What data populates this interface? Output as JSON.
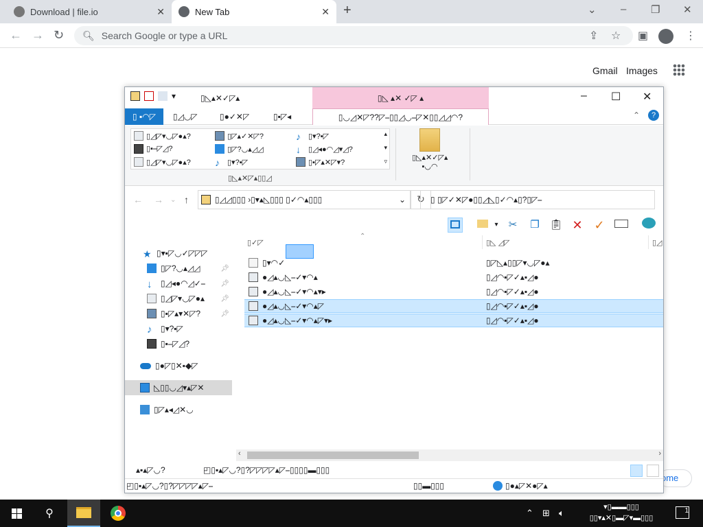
{
  "browser": {
    "tabs": [
      {
        "title": "Download | file.io",
        "active": false
      },
      {
        "title": "New Tab",
        "active": true
      }
    ],
    "omnibox_placeholder": "Search Google or type a URL"
  },
  "google": {
    "gmail": "Gmail",
    "images": "Images",
    "partial_button": "ome"
  },
  "explorer": {
    "title": "▯◺▴✕✓◸▴",
    "context_tab_header": "▯◺ ▴✕ ✓◸ ▴",
    "ribbon_tabs": [
      "▯ ▪◠◸",
      "▯◿◡◸",
      "▯●✓✕◸",
      "▯▪◸◂",
      "▯◡◿✕◸??◸⎯▯▯◿◡⎯◸✕▯▯◿◿◠?"
    ],
    "layout_items": [
      "▯◿◸▾◡◸●▴?",
      "▯◸▴✓✕◸?",
      "▯▾?▪◸",
      "▯▪⎯◸◿?",
      "▯◸?◡▴◿◿",
      "▯◿◂●◠◿▾◿?",
      "▯◿◸▾◡◸●▴?",
      "▯▾?▪◸",
      "▯▪◸▴✕◸▾?"
    ],
    "group_label": "▯◺▴✕◸▴▯▯◿",
    "sortby_label": "▯◺▴✕✓◸▴\n▪◡◠",
    "address_text": "▯◿◿▯▯▯ ›▯▾▴◺▯▯▯ ▯✓◠▴▯▯▯",
    "search_placeholder": "▯ ▯◸✓✕◸●▯▯◿◺▯✓◠▴▯?▯◸⎯",
    "columns": {
      "name": "▯✓◸",
      "type": "▯◺ ◿◸"
    },
    "files": [
      {
        "name": "▯▾◠✓",
        "type": "▯◸◺▴▯▯◸▾◡◸●▴",
        "selected": false,
        "icon": "text-file-icon"
      },
      {
        "name": "●◿▴◡◺⎯✓▾◠▴",
        "type": "▯◿◠▪◸✓▴▪◿●",
        "selected": false,
        "icon": "image-file-icon"
      },
      {
        "name": "●◿▴◡◺⎯✓▾◠▴▾▸",
        "type": "▯◿◠▪◸✓▴▪◿●",
        "selected": false,
        "icon": "image-file-icon"
      },
      {
        "name": "●◿▴◡◺⎯✓▾◠▴◸",
        "type": "▯◿◠▪◸✓▴▪◿●",
        "selected": true,
        "icon": "image-file-icon"
      },
      {
        "name": "●◿▴◡◺⎯✓▾◠▴◸▾▸",
        "type": "▯◿◠▪◸✓▴▪◿●",
        "selected": true,
        "icon": "image-file-icon"
      }
    ],
    "nav": [
      {
        "label": "▯▾▪◸◡✓◸◸◸",
        "icon": "quick-access-star-icon",
        "pinned": false
      },
      {
        "label": "▯◸?◡▴◿◿",
        "icon": "desktop-icon",
        "pinned": true
      },
      {
        "label": "▯◿◂●◠◿✓⎯",
        "icon": "downloads-icon",
        "pinned": true
      },
      {
        "label": "▯◿◸▾◡◸●▴",
        "icon": "documents-icon",
        "pinned": true
      },
      {
        "label": "▯▪◸▴▾✕◸?",
        "icon": "pictures-icon",
        "pinned": true
      },
      {
        "label": "▯▾?▪◸",
        "icon": "music-icon",
        "pinned": false
      },
      {
        "label": "▯▪⎯◸◿?",
        "icon": "videos-icon",
        "pinned": false
      },
      {
        "label": "▯●◸▯✕▪◆◸",
        "icon": "onedrive-icon",
        "pinned": false
      },
      {
        "label": "◺▯▯◡◿▾▴◸✕",
        "icon": "this-pc-icon",
        "pinned": false,
        "selected": true
      },
      {
        "label": "▯◸▴◂◿✕◡",
        "icon": "network-icon",
        "pinned": false
      }
    ],
    "status_items": "▴▪▴◸◡?",
    "status_selected": "◰▯▪▴◸◡?▯?◸◸◸◸▴◸⎯▯▯▯▯▬▯▯▯",
    "status2_left": "◰▯▪▴◸◡?▯?◸◸◸◸▴◸⎯",
    "status2_size": "▯▯▬▯▯▯",
    "status2_zone": "▯●▴◸✕●◸▴"
  },
  "taskbar": {
    "clock_time": "▾▯▬▬▯▯▯",
    "clock_date": "▯▯▾▴✕▯▬◸▾▬▯▯▯",
    "notif_count": "1"
  }
}
